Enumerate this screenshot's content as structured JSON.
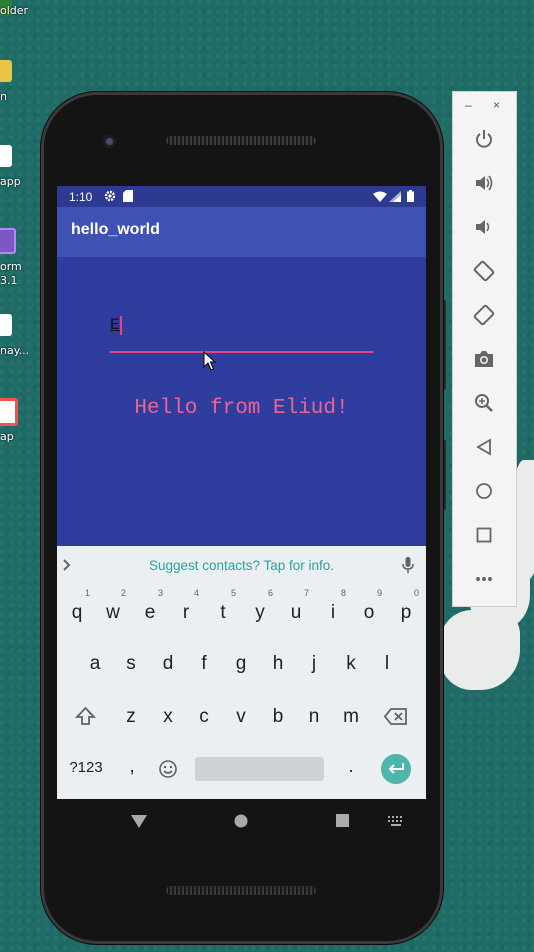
{
  "desktop": {
    "icons": [
      {
        "label": "older",
        "color": "#2e7d32"
      },
      {
        "label": "n",
        "color": "#e8c547"
      },
      {
        "label": "app",
        "color": "#ffffff"
      },
      {
        "label": "orm",
        "color": "#7e57c2"
      },
      {
        "label": "3.1",
        "color": ""
      },
      {
        "label": "nay...",
        "color": "#ffffff"
      },
      {
        "label": "ap",
        "color": "#ef5350"
      }
    ]
  },
  "status_bar": {
    "time": "1:10",
    "icons": [
      "gear-icon",
      "sd-card-icon",
      "wifi-icon",
      "signal-icon",
      "battery-icon"
    ]
  },
  "app_bar": {
    "title": "hello_world"
  },
  "edit_text": {
    "value": "E"
  },
  "greeting": {
    "text": "Hello from Eliud!"
  },
  "keyboard": {
    "suggestion": "Suggest contacts? Tap for info.",
    "row1": [
      "q",
      "w",
      "e",
      "r",
      "t",
      "y",
      "u",
      "i",
      "o",
      "p"
    ],
    "row1_hints": [
      "1",
      "2",
      "3",
      "4",
      "5",
      "6",
      "7",
      "8",
      "9",
      "0"
    ],
    "row2": [
      "a",
      "s",
      "d",
      "f",
      "g",
      "h",
      "j",
      "k",
      "l"
    ],
    "row3": [
      "z",
      "x",
      "c",
      "v",
      "b",
      "n",
      "m"
    ],
    "symbols_label": "?123",
    "comma": ",",
    "period": ".",
    "accent_color": "#4db6ac"
  },
  "emulator_toolbar": {
    "minimize": "–",
    "close": "×",
    "buttons": [
      "power-icon",
      "volume-up-icon",
      "volume-down-icon",
      "rotate-left-icon",
      "rotate-right-icon",
      "camera-icon",
      "zoom-icon",
      "back-icon",
      "home-icon",
      "overview-icon",
      "more-icon"
    ]
  }
}
